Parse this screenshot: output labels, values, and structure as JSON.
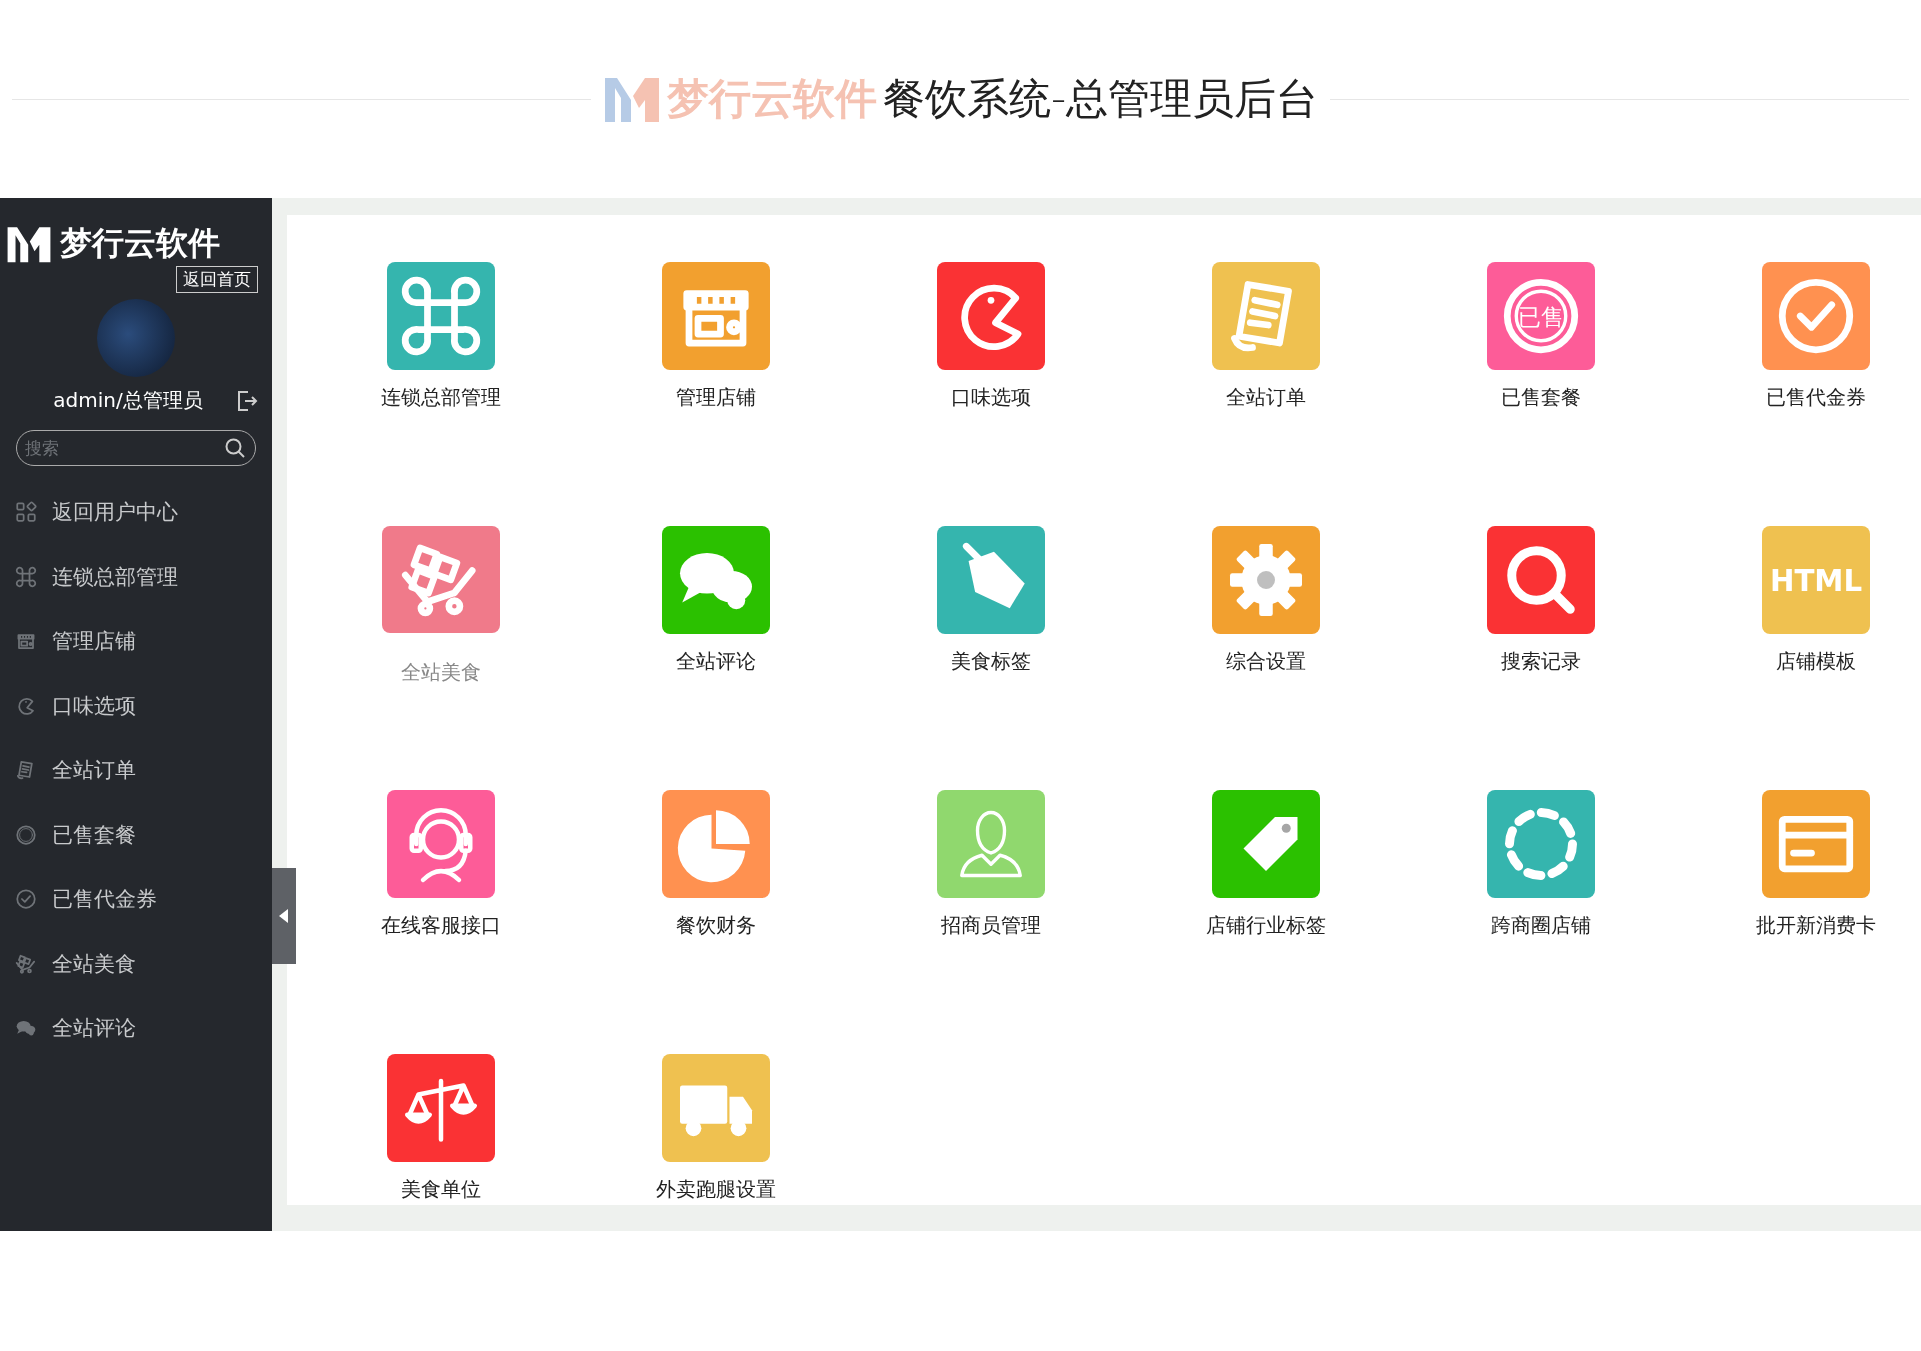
{
  "header": {
    "brand": "梦行云软件",
    "title": "餐饮系统-总管理员后台"
  },
  "sidebar": {
    "brand": "梦行云软件",
    "home_link": "返回首页",
    "user": "admin/总管理员",
    "search": {
      "placeholder": "搜索"
    },
    "items": [
      {
        "kind": "grid",
        "label": "返回用户中心"
      },
      {
        "kind": "command",
        "label": "连锁总部管理"
      },
      {
        "kind": "store",
        "label": "管理店铺"
      },
      {
        "kind": "pacman",
        "label": "口味选项"
      },
      {
        "kind": "receipt",
        "label": "全站订单"
      },
      {
        "kind": "stamp",
        "label": "已售套餐"
      },
      {
        "kind": "check",
        "label": "已售代金券"
      },
      {
        "kind": "cart",
        "label": "全站美食"
      },
      {
        "kind": "chat",
        "label": "全站评论"
      }
    ]
  },
  "tiles": [
    {
      "kind": "command",
      "label": "连锁总部管理",
      "color": "#35b5ae",
      "highlighted": false
    },
    {
      "kind": "store",
      "label": "管理店铺",
      "color": "#f2a02f",
      "highlighted": false
    },
    {
      "kind": "pacman",
      "label": "口味选项",
      "color": "#fa3234",
      "highlighted": false
    },
    {
      "kind": "receipt",
      "label": "全站订单",
      "color": "#efc150",
      "highlighted": false
    },
    {
      "kind": "stamp",
      "label": "已售套餐",
      "glyph": "已售",
      "color": "#fd5c98",
      "highlighted": false
    },
    {
      "kind": "check",
      "label": "已售代金券",
      "color": "#ff9150",
      "highlighted": false
    },
    {
      "kind": "cart",
      "label": "全站美食",
      "color": "#f07a8a",
      "highlighted": true
    },
    {
      "kind": "chat",
      "label": "全站评论",
      "color": "#2bc100",
      "highlighted": false
    },
    {
      "kind": "pricetag",
      "label": "美食标签",
      "color": "#35b5ae",
      "highlighted": false
    },
    {
      "kind": "gear",
      "label": "综合设置",
      "color": "#f2a02f",
      "highlighted": false
    },
    {
      "kind": "search",
      "label": "搜索记录",
      "color": "#fa3234",
      "highlighted": false
    },
    {
      "kind": "html",
      "label": "店铺模板",
      "glyph": "HTML",
      "color": "#efc150",
      "highlighted": false
    },
    {
      "kind": "headset",
      "label": "在线客服接口",
      "color": "#fd5c98",
      "highlighted": false
    },
    {
      "kind": "pie",
      "label": "餐饮财务",
      "color": "#ff9150",
      "highlighted": false
    },
    {
      "kind": "person",
      "label": "招商员管理",
      "color": "#90d86e",
      "highlighted": false
    },
    {
      "kind": "tag",
      "label": "店铺行业标签",
      "color": "#2bc100",
      "highlighted": false
    },
    {
      "kind": "dashed",
      "label": "跨商圈店铺",
      "color": "#35b5ae",
      "highlighted": false
    },
    {
      "kind": "card",
      "label": "批开新消费卡",
      "color": "#f2a02f",
      "highlighted": false
    },
    {
      "kind": "scale",
      "label": "美食单位",
      "color": "#fa3234",
      "highlighted": false
    },
    {
      "kind": "truck",
      "label": "外卖跑腿设置",
      "color": "#efc150",
      "highlighted": false
    }
  ]
}
